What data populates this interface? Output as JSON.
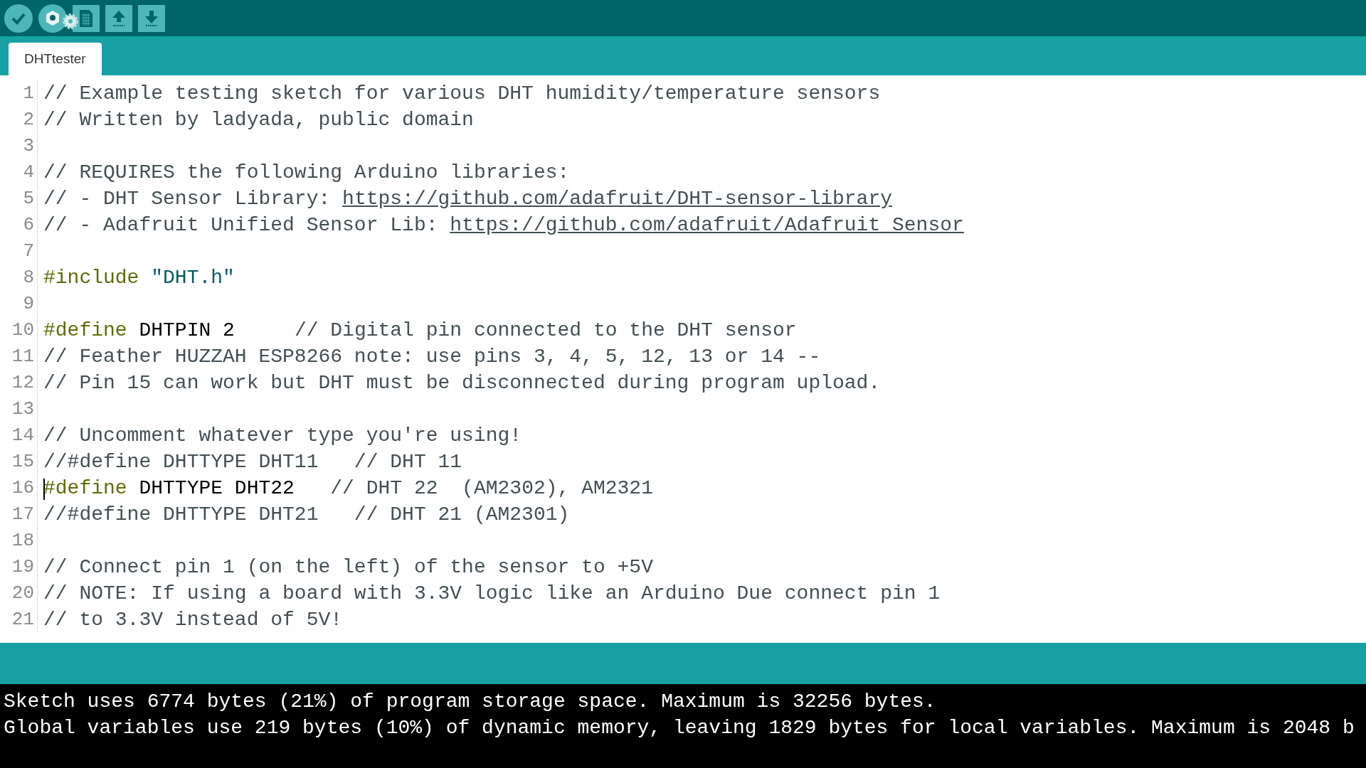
{
  "toolbar": {
    "buttons": [
      {
        "kind": "verify"
      },
      {
        "kind": "upload"
      },
      {
        "kind": "new"
      },
      {
        "kind": "open"
      },
      {
        "kind": "save"
      }
    ]
  },
  "tabs": [
    {
      "label": "DHTtester",
      "selected": true
    }
  ],
  "editor": {
    "lines": [
      {
        "number": "1",
        "segments": [
          {
            "kind": "comment",
            "text": "// Example testing sketch for various DHT humidity/temperature sensors"
          }
        ]
      },
      {
        "number": "2",
        "segments": [
          {
            "kind": "comment",
            "text": "// Written by ladyada, public domain"
          }
        ]
      },
      {
        "number": "3"
      },
      {
        "number": "4",
        "segments": [
          {
            "kind": "comment",
            "text": "// REQUIRES the following Arduino libraries:"
          }
        ]
      },
      {
        "number": "5",
        "segments": [
          {
            "kind": "comment",
            "text": "// - DHT Sensor Library: "
          },
          {
            "kind": "link",
            "text": "https://github.com/adafruit/DHT-sensor-library"
          }
        ]
      },
      {
        "number": "6",
        "segments": [
          {
            "kind": "comment",
            "text": "// - Adafruit Unified Sensor Lib: "
          },
          {
            "kind": "link",
            "text": "https://github.com/adafruit/Adafruit_Sensor"
          }
        ]
      },
      {
        "number": "7"
      },
      {
        "number": "8",
        "segments": [
          {
            "kind": "keyword",
            "text": "#include"
          },
          {
            "kind": "string",
            "text": "\"DHT.h\""
          }
        ]
      },
      {
        "number": "9"
      },
      {
        "number": "10",
        "segments": [
          {
            "kind": "keyword",
            "text": "#define"
          },
          {
            "kind": "plain",
            "text": " DHTPIN 2     "
          },
          {
            "kind": "comment",
            "text": "// Digital pin connected to the DHT sensor"
          }
        ]
      },
      {
        "number": "11",
        "segments": [
          {
            "kind": "comment",
            "text": "// Feather HUZZAH ESP8266 note: use pins 3, 4, 5, 12, 13 or 14 --"
          }
        ]
      },
      {
        "number": "12",
        "segments": [
          {
            "kind": "comment",
            "text": "// Pin 15 can work but DHT must be disconnected during program upload."
          }
        ]
      },
      {
        "number": "13"
      },
      {
        "number": "14",
        "segments": [
          {
            "kind": "comment",
            "text": "// Uncomment whatever type you're using!"
          }
        ]
      },
      {
        "number": "15",
        "segments": [
          {
            "kind": "comment",
            "text": "//#define DHTTYPE DHT11   // DHT 11"
          }
        ]
      },
      {
        "number": "16",
        "cursor": true,
        "segments": [
          {
            "kind": "keyword",
            "text": "#define"
          },
          {
            "kind": "plain",
            "text": " DHTTYPE DHT22   "
          },
          {
            "kind": "comment",
            "text": "// DHT 22  (AM2302), AM2321"
          }
        ]
      },
      {
        "number": "17",
        "segments": [
          {
            "kind": "comment",
            "text": "//#define DHTTYPE DHT21   // DHT 21 (AM2301)"
          }
        ]
      },
      {
        "number": "18"
      },
      {
        "number": "19",
        "segments": [
          {
            "kind": "comment",
            "text": "// Connect pin 1 (on the left) of the sensor to +5V"
          }
        ]
      },
      {
        "number": "20",
        "segments": [
          {
            "kind": "comment",
            "text": "// NOTE: If using a board with 3.3V logic like an Arduino Due connect pin 1"
          }
        ]
      },
      {
        "number": "21",
        "segments": [
          {
            "kind": "comment",
            "text": "// to 3.3V instead of 5V!"
          }
        ]
      }
    ]
  },
  "console": {
    "lines": [
      "Sketch uses 6774 bytes (21%) of program storage space. Maximum is 32256 bytes.",
      "Global variables use 219 bytes (10%) of dynamic memory, leaving 1829 bytes for local variables. Maximum is 2048 b"
    ]
  }
}
